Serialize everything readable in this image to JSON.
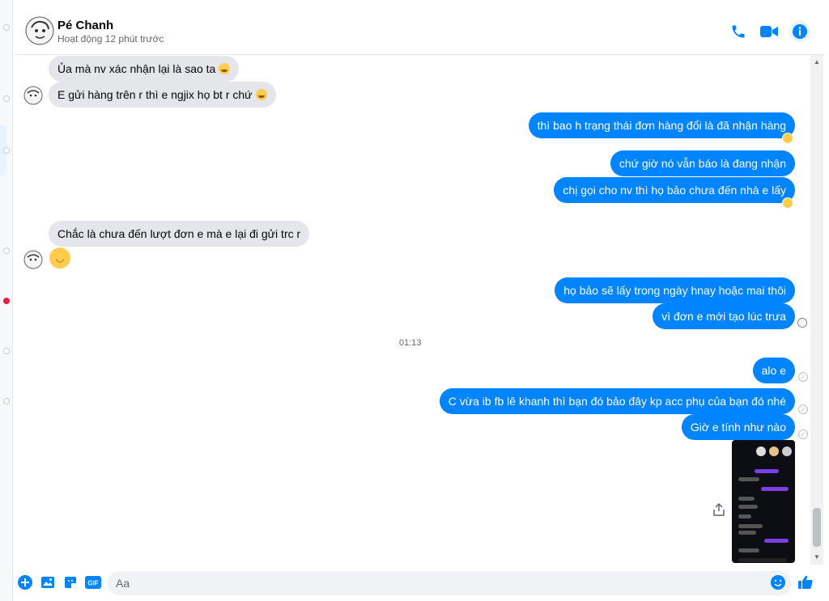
{
  "header": {
    "contact_name": "Pé Chanh",
    "status": "Hoạt động 12 phút trước"
  },
  "messages": {
    "m1": "Ủa mà nv xác nhận lại là sao ta",
    "m2": "E gửi hàng trên r thì e ngjix họ bt r chứ",
    "m3": "thì bao h trạng thái đơn hàng đổi là đã nhận hàng",
    "m4": "chứ giờ nó vẫn báo là đang nhận",
    "m5": "chị gọi cho nv thì họ bảo chưa đến nhà e lấy",
    "m6": "Chắc là chưa đến lượt đơn e mà e lại đi gửi trc r",
    "m7": "họ bảo sẽ lấy trong ngày hnay hoặc mai thôi",
    "m8": "vì đơn e mới tạo lúc trưa",
    "m9": "alo e",
    "m10": "C vừa ib fb lê khanh thì bạn đó bảo đây kp acc phụ của bạn đó nhé",
    "m11": "Giờ e tính như nào"
  },
  "timestamp": "01:13",
  "composer": {
    "placeholder": "Aa"
  },
  "colors": {
    "accent": "#0084ff",
    "incoming_bubble": "#e4e6eb",
    "emoji": "#ffcc4d"
  },
  "icons": [
    "phone-icon",
    "video-icon",
    "info-icon",
    "plus-icon",
    "image-icon",
    "sticker-icon",
    "gif-icon",
    "emoji-icon",
    "like-icon",
    "share-icon"
  ]
}
